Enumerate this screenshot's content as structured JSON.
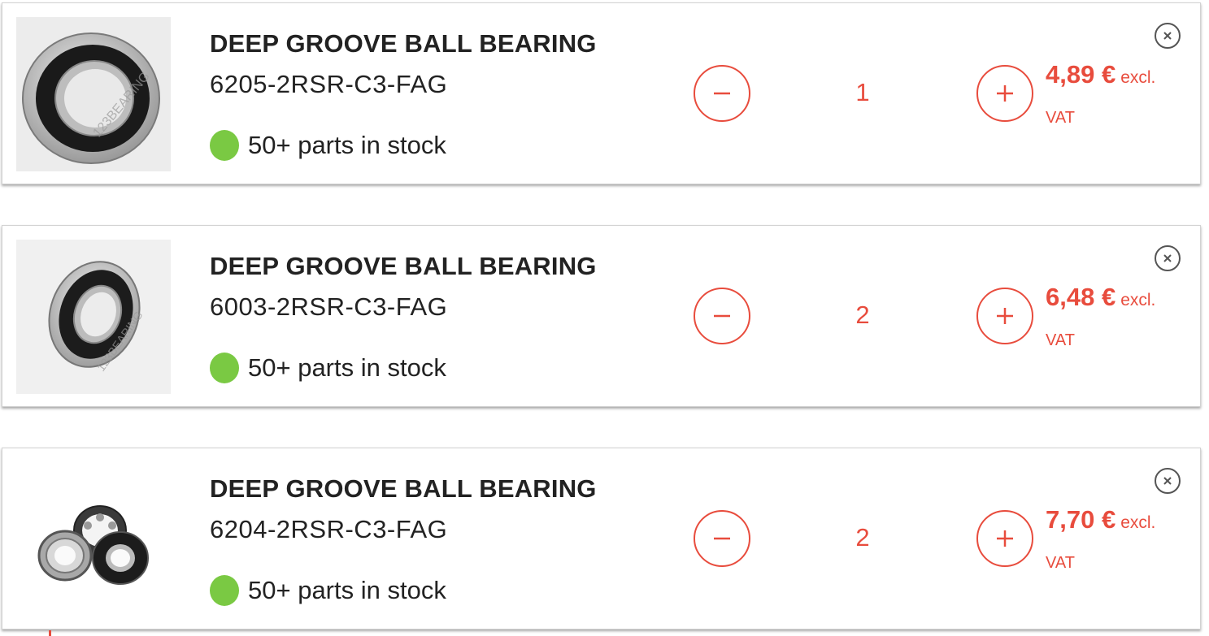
{
  "cart": {
    "items": [
      {
        "image_icon": "bearing-front-icon",
        "title": "DEEP GROOVE BALL BEARING",
        "sku": "6205-2RSR-C3-FAG",
        "stock_text": "50+ parts in stock",
        "stock_color": "#7ac943",
        "quantity": "1",
        "price": "4,89 €",
        "price_suffix": "excl.",
        "price_vat": "VAT"
      },
      {
        "image_icon": "bearing-angled-icon",
        "title": "DEEP GROOVE BALL BEARING",
        "sku": "6003-2RSR-C3-FAG",
        "stock_text": "50+ parts in stock",
        "stock_color": "#7ac943",
        "quantity": "2",
        "price": "6,48 €",
        "price_suffix": "excl.",
        "price_vat": "VAT"
      },
      {
        "image_icon": "bearing-group-icon",
        "title": "DEEP GROOVE BALL BEARING",
        "sku": "6204-2RSR-C3-FAG",
        "stock_text": "50+ parts in stock",
        "stock_color": "#7ac943",
        "quantity": "2",
        "price": "7,70 €",
        "price_suffix": "excl.",
        "price_vat": "VAT"
      }
    ]
  },
  "colors": {
    "accent": "#e84c3d",
    "text": "#222222",
    "stock_ok": "#7ac943"
  }
}
